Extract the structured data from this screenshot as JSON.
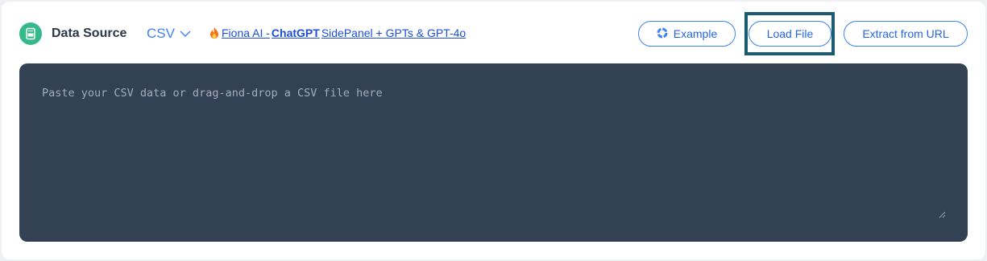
{
  "header": {
    "title": "Data Source",
    "title_icon": "csv-file-icon",
    "format_select": {
      "value": "CSV",
      "icon": "chevron-down-icon"
    },
    "promo_link": {
      "icon": "fire-icon",
      "prefix": "Fiona AI - ",
      "bold": "ChatGPT",
      "suffix": " SidePanel + GPTs & GPT-4o"
    },
    "buttons": {
      "example": "Example",
      "load_file": "Load File",
      "extract_url": "Extract from URL"
    }
  },
  "editor": {
    "value": "",
    "placeholder": "Paste your CSV data or drag-and-drop a CSV file here"
  },
  "colors": {
    "accent": "#3b82f6",
    "icon_green": "#35b98a",
    "editor_bg": "#334155",
    "focus_ring": "#1b5a73"
  }
}
